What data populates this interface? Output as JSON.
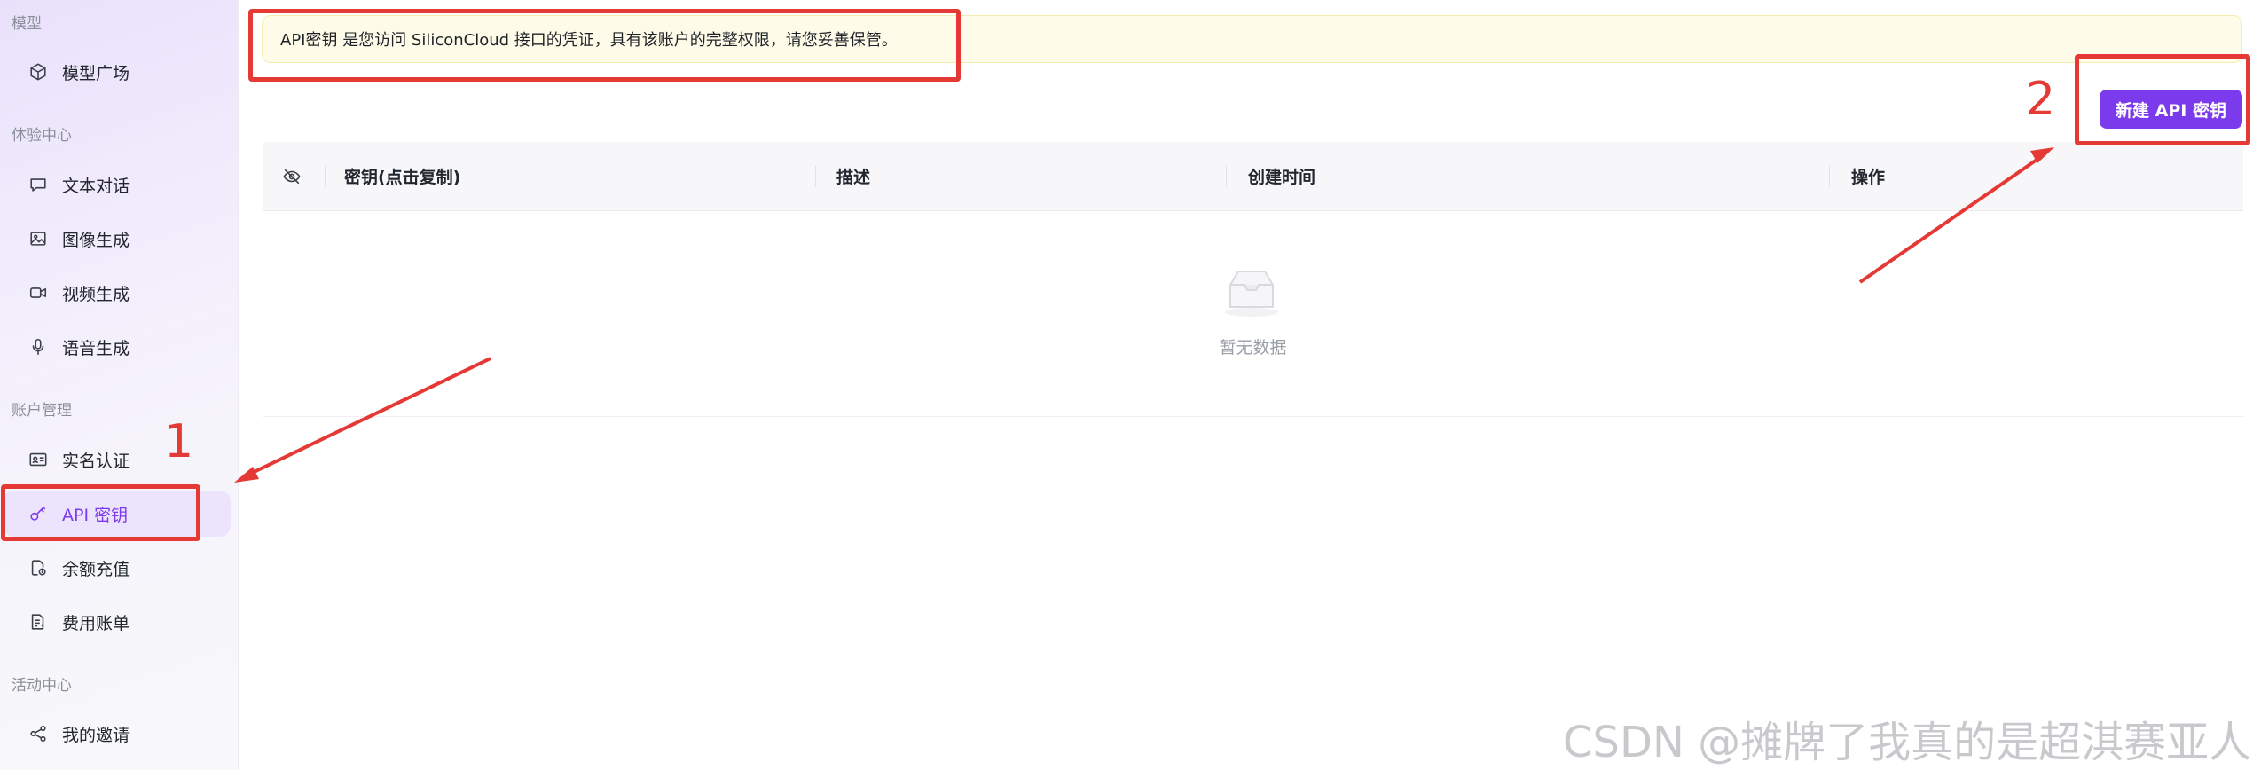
{
  "sidebar": {
    "sections": [
      {
        "label": "模型",
        "items": [
          {
            "label": "模型广场",
            "icon": "cube-icon"
          }
        ]
      },
      {
        "label": "体验中心",
        "items": [
          {
            "label": "文本对话",
            "icon": "chat-bubble-icon"
          },
          {
            "label": "图像生成",
            "icon": "image-icon"
          },
          {
            "label": "视频生成",
            "icon": "video-camera-icon"
          },
          {
            "label": "语音生成",
            "icon": "microphone-icon"
          }
        ]
      },
      {
        "label": "账户管理",
        "items": [
          {
            "label": "实名认证",
            "icon": "id-card-icon"
          },
          {
            "label": "API 密钥",
            "icon": "key-icon",
            "active": true
          },
          {
            "label": "余额充值",
            "icon": "wallet-icon"
          },
          {
            "label": "费用账单",
            "icon": "bill-icon"
          }
        ]
      },
      {
        "label": "活动中心",
        "items": [
          {
            "label": "我的邀请",
            "icon": "share-icon"
          }
        ]
      }
    ]
  },
  "notice": {
    "text": "API密钥 是您访问 SiliconCloud 接口的凭证，具有该账户的完整权限，请您妥善保管。"
  },
  "toolbar": {
    "create_label": "新建 API 密钥"
  },
  "table": {
    "columns": [
      "密钥(点击复制)",
      "描述",
      "创建时间",
      "操作"
    ],
    "rows": [],
    "empty_text": "暂无数据"
  },
  "annotations": {
    "num1": "1",
    "num2": "2"
  },
  "watermark": "CSDN @摊牌了我真的是超淇赛亚人",
  "colors": {
    "accent": "#7c3aed",
    "annotation": "#e53935",
    "notice_bg": "#fefce9"
  }
}
